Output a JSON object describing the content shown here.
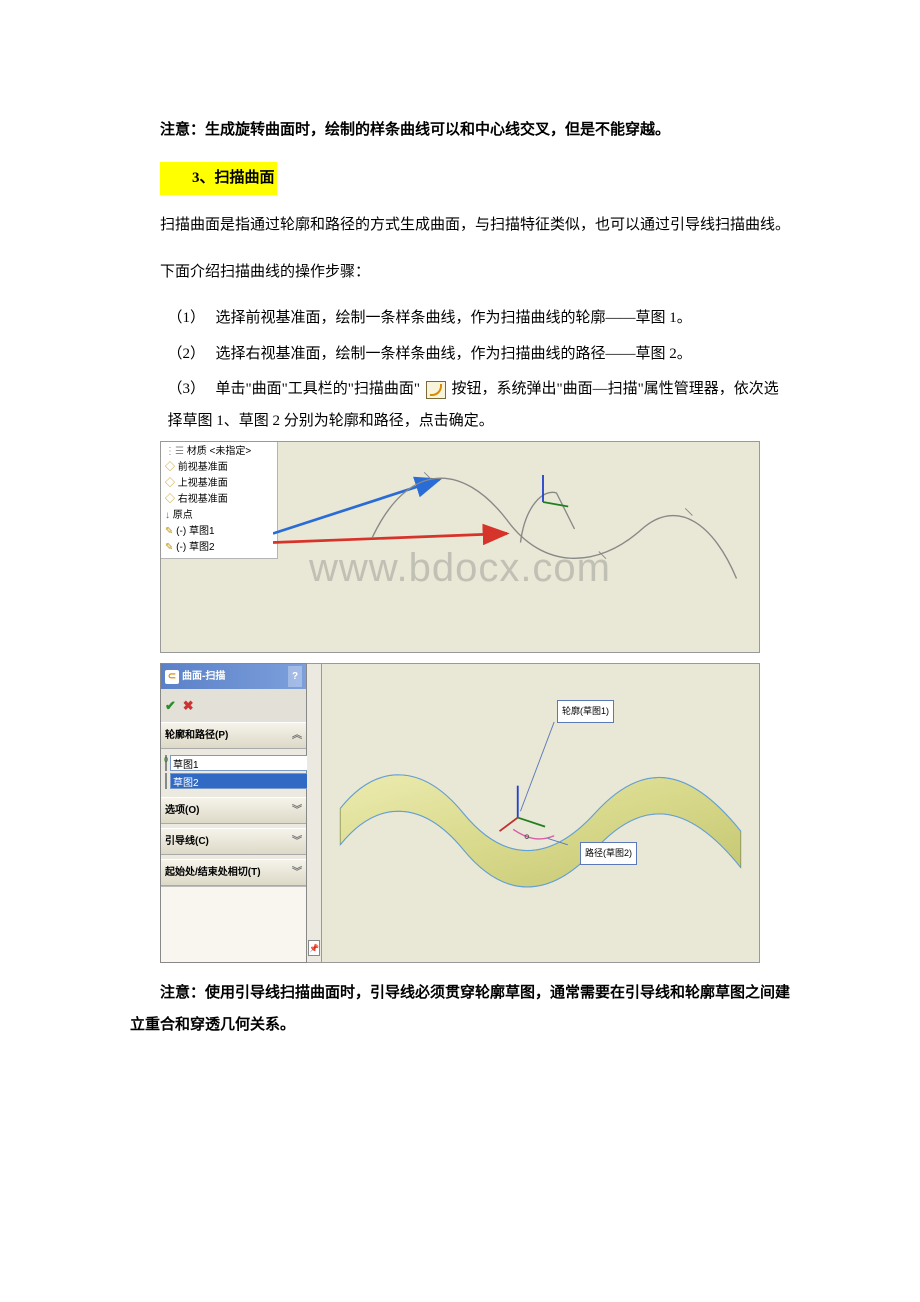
{
  "text": {
    "note1": "注意：生成旋转曲面时，绘制的样条曲线可以和中心线交叉，但是不能穿越。",
    "heading": "3、扫描曲面",
    "p1": "扫描曲面是指通过轮廓和路径的方式生成曲面，与扫描特征类似，也可以通过引导线扫描曲线。",
    "p2": "下面介绍扫描曲线的操作步骤：",
    "li1": "选择前视基准面，绘制一条样条曲线，作为扫描曲线的轮廓——草图 1。",
    "li2": "选择右视基准面，绘制一条样条曲线，作为扫描曲线的路径——草图 2。",
    "li3a": "单击\"曲面\"工具栏的\"扫描曲面\"",
    "li3b": "按钮，系统弹出\"曲面—扫描\"属性管理器，依次选择草图 1、草图 2 分别为轮廓和路径，点击确定。",
    "note2": "注意：使用引导线扫描曲面时，引导线必须贯穿轮廓草图，通常需要在引导线和轮廓草图之间建立重合和穿透几何关系。",
    "n1": "（1）",
    "n2": "（2）",
    "n3": "（3）"
  },
  "fig1": {
    "tree": {
      "material": "材质 <未指定>",
      "plane_front": "前视基准面",
      "plane_top": "上视基准面",
      "plane_right": "右视基准面",
      "origin": "原点",
      "sketch1": "(-) 草图1",
      "sketch2": "(-) 草图2"
    },
    "watermark": "www.bdocx.com"
  },
  "fig2": {
    "pm": {
      "title": "曲面-扫描",
      "help": "?",
      "sec_profile": "轮廓和路径(P)",
      "field1": "草图1",
      "field2": "草图2",
      "sec_options": "选项(O)",
      "sec_guide": "引导线(C)",
      "sec_tan": "起始处/结束处相切(T)"
    },
    "callout_profile": "轮廓(草图1)",
    "callout_path": "路径(草图2)"
  }
}
